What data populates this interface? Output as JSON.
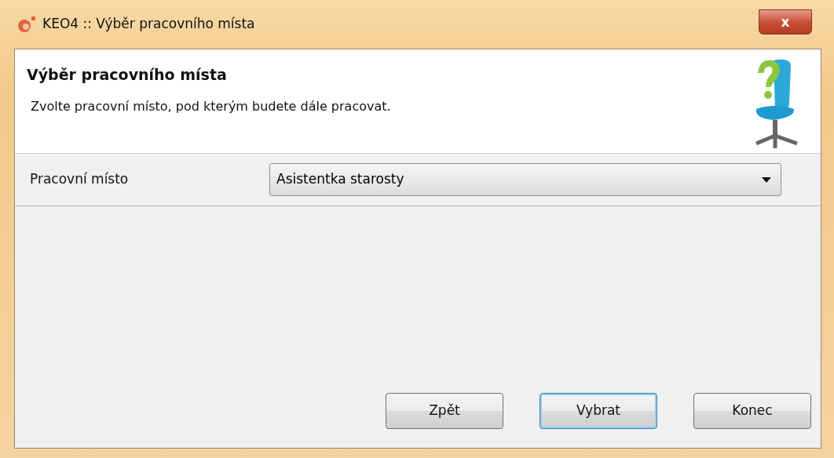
{
  "window": {
    "title": "KEO4 :: Výběr pracovního místa",
    "close": "x"
  },
  "header": {
    "title": "Výběr pracovního místa",
    "subtitle": "Zvolte pracovní místo, pod kterým budete dále pracovat."
  },
  "field": {
    "label": "Pracovní místo",
    "value": "Asistentka starosty"
  },
  "buttons": [
    {
      "label": "Zpět",
      "default": false
    },
    {
      "label": "Vybrat",
      "default": true
    },
    {
      "label": "Konec",
      "default": false
    }
  ]
}
